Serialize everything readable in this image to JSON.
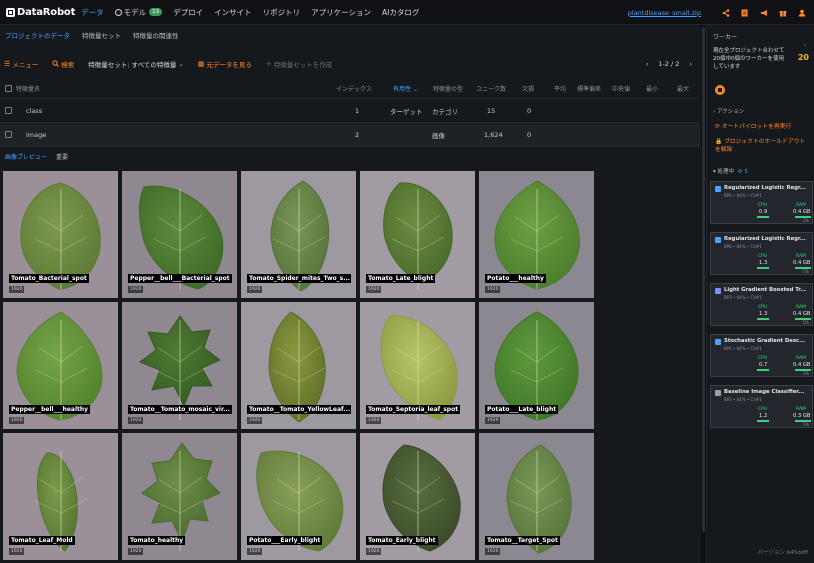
{
  "app": {
    "logo": "DataRobot",
    "nav": [
      "データ",
      "モデル",
      "デプロイ",
      "インサイト",
      "リポジトリ",
      "アプリケーション",
      "AIカタログ"
    ],
    "model_badge": "13",
    "file_name": "plantdisease_small.zip",
    "toolbar_icons": [
      "share-icon",
      "document-icon",
      "megaphone-icon",
      "gift-icon",
      "user-icon"
    ]
  },
  "subtabs": [
    "プロジェクトのデータ",
    "特徴量セット",
    "特徴量の関連性"
  ],
  "toolbar": {
    "menu": "メニュー",
    "search": "検索",
    "feature_set": "特徴量セット: すべての特徴量",
    "view_raw": "元データを見る",
    "create_set": "特徴量セットを作成",
    "pager": "1-2 / 2"
  },
  "table": {
    "headers": [
      "特徴量名",
      "インデックス",
      "有用性",
      "特徴量の型",
      "ユニーク数",
      "欠損",
      "平均",
      "標準偏差",
      "中央値",
      "最小",
      "最大"
    ],
    "rows": [
      {
        "name": "class",
        "index": "1",
        "importance": "ターゲット",
        "type": "カテゴリ",
        "unique": "15",
        "missing": "0"
      },
      {
        "name": "image",
        "index": "2",
        "importance": "",
        "type": "画像",
        "unique": "1,624",
        "missing": "0"
      }
    ]
  },
  "preview_tabs": [
    "画像プレビュー",
    "重要"
  ],
  "images": [
    {
      "label": "Tomato_Bacterial_spot",
      "size": "1920"
    },
    {
      "label": "Pepper__bell___Bacterial_spot",
      "size": "1920"
    },
    {
      "label": "Tomato_Spider_mites_Two_s...",
      "size": "1920"
    },
    {
      "label": "Tomato_Late_blight",
      "size": "1920"
    },
    {
      "label": "Potato___healthy",
      "size": "1920"
    },
    {
      "label": "Pepper__bell___healthy",
      "size": "1920"
    },
    {
      "label": "Tomato__Tomato_mosaic_vir...",
      "size": "1920"
    },
    {
      "label": "Tomato__Tomato_YellowLeaf...",
      "size": "1920"
    },
    {
      "label": "Tomato_Septoria_leaf_spot",
      "size": "1920"
    },
    {
      "label": "Potato___Late_blight",
      "size": "1920"
    },
    {
      "label": "Tomato_Leaf_Mold",
      "size": "1920"
    },
    {
      "label": "Tomato_healthy",
      "size": "1920"
    },
    {
      "label": "Potato___Early_blight",
      "size": "1920"
    },
    {
      "label": "Tomato_Early_blight",
      "size": "1920"
    },
    {
      "label": "Tomato__Target_Spot",
      "size": "1920"
    }
  ],
  "workers": {
    "title": "ワーカー",
    "description": "現在全プロジェクト合わせて20個中0個のワーカーを使用しています",
    "count": "20",
    "actions_title": "アクション",
    "action_autopilot": "オートパイロットを再実行",
    "action_holdout": "プロジェクトのホールドアウトを解除",
    "running_title": "処理中",
    "running_count": "5",
    "jobs": [
      {
        "name": "Regularized Logistic Regr...",
        "sub": "BP6 • 64% • CV#1",
        "cpu": "0.9",
        "ram": "0.4 GB",
        "pct": "1%",
        "color": "#4aa3ff"
      },
      {
        "name": "Regularized Logistic Regr...",
        "sub": "BP6 • 64% • CV#1",
        "cpu": "1.3",
        "ram": "0.4 GB",
        "pct": "1%",
        "color": "#4aa3ff"
      },
      {
        "name": "Light Gradient Boosted Tr...",
        "sub": "BP3 • 64% • CV#1",
        "cpu": "1.3",
        "ram": "0.4 GB",
        "pct": "1%",
        "color": "#7d8cff"
      },
      {
        "name": "Stochastic Gradient Desc...",
        "sub": "BP4 • 64% • CV#1",
        "cpu": "0.7",
        "ram": "0.4 GB",
        "pct": "1%",
        "color": "#4aa3ff"
      },
      {
        "name": "Baseline Image Classifier...",
        "sub": "BP2 • 64% • CV#1",
        "cpu": "1.2",
        "ram": "0.3 GB",
        "pct": "1%",
        "color": "#9aa0a7"
      }
    ],
    "cpu_label": "CPU",
    "ram_label": "RAM",
    "version": "バージョン b45ddff"
  },
  "colors": {
    "accent_blue": "#4aa3ff",
    "accent_orange": "#ff8a2a",
    "worker_yellow": "#f2b21b",
    "ok_green": "#3dd17a"
  }
}
